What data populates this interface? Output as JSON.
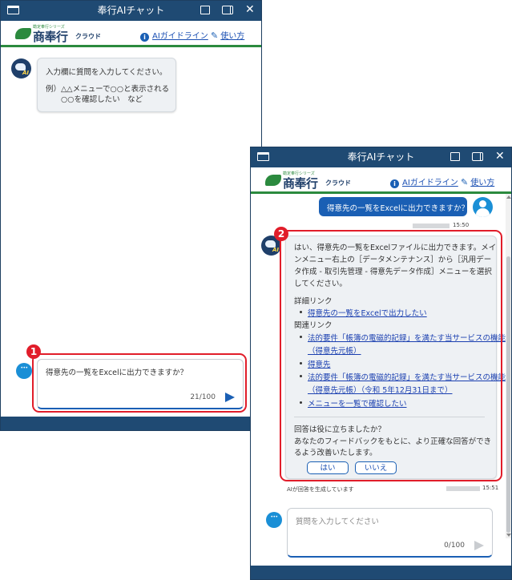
{
  "app": {
    "title": "奉行AIチャット",
    "logo_sub": "勘定奉行シリーズ",
    "logo_main": "商奉行",
    "logo_cloud": "クラウド",
    "guide_link": "AIガイドライン",
    "howto_link": "使い方"
  },
  "window1": {
    "greeting": [
      "入力欄に質問を入力してください。",
      "例）△△メニューで○○と表示される",
      "　　○○を確認したい　など"
    ],
    "input": {
      "value": "得意先の一覧をExcelに出力できますか？",
      "counter": "21/100"
    }
  },
  "window2": {
    "user_message": "得意先の一覧をExcelに出力できますか？",
    "user_time": "15:50",
    "answer_lines": [
      "はい、得意先の一覧をExcelファイルに出力できます。メイ",
      "ンメニュー右上の［データメンテナンス］から［汎用デー",
      "タ作成 - 取引先管理 - 得意先データ作成］メニューを選択",
      "してください。"
    ],
    "detail_label": "詳細リンク",
    "detail_link": "得意先の一覧をExcelで出力したい",
    "related_label": "関連リンク",
    "related_links": [
      "法的要件「帳簿の電磁的記録」を満たす当サービスの機能",
      "（得意先元帳）",
      "得意先",
      "法的要件「帳簿の電磁的記録」を満たす当サービスの機能",
      "（得意先元帳）（令和 5年12月31日まで）",
      "メニューを一覧で確認したい"
    ],
    "feedback_lines": [
      "回答は役に立ちましたか？",
      "あなたのフィードバックをもとに、より正確な回答ができ",
      "るよう改善いたします。"
    ],
    "yes_label": "はい",
    "no_label": "いいえ",
    "generated_note": "AIが回答を生成しています",
    "answer_time": "15:51",
    "input": {
      "placeholder": "質問を入力してください",
      "counter": "0/100"
    }
  },
  "callouts": [
    "1",
    "2"
  ],
  "colors": {
    "titlebar": "#1f4a73",
    "accent_green": "#2b8a3e",
    "accent_blue": "#1a5fb4",
    "callout_red": "#e11d2a"
  }
}
